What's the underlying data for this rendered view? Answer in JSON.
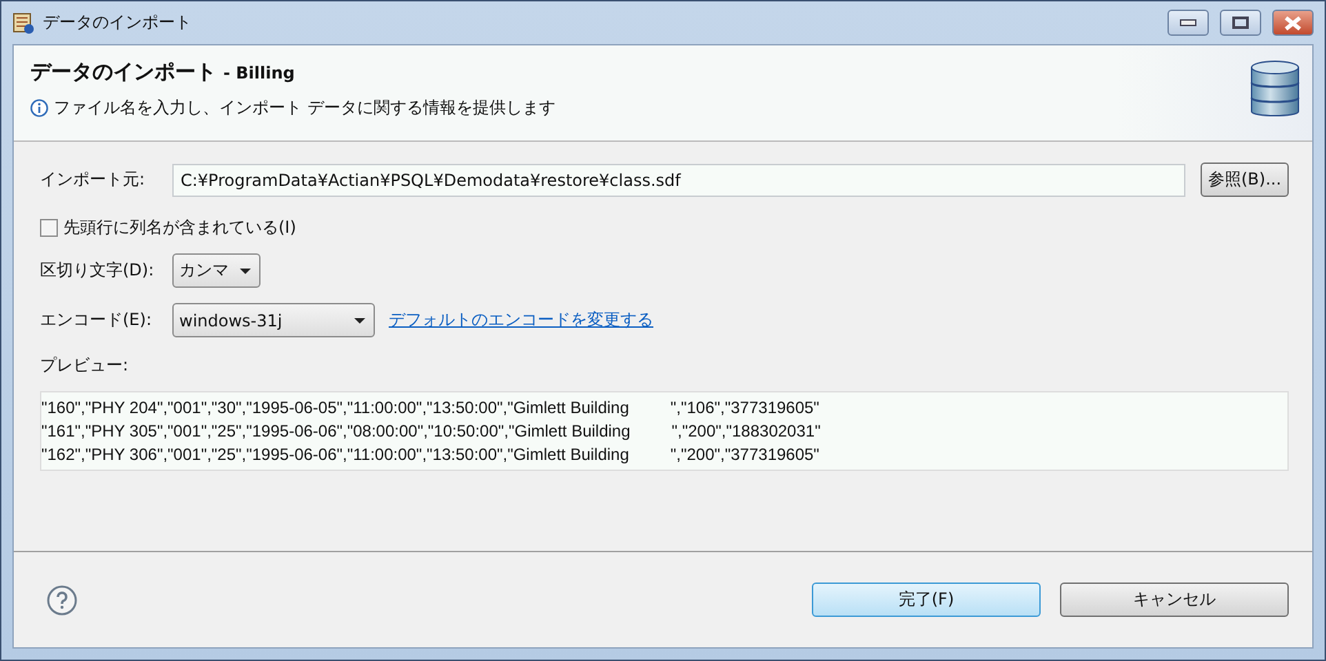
{
  "window": {
    "title": "データのインポート"
  },
  "header": {
    "title": "データのインポート",
    "subtitle": "- Billing",
    "message": "ファイル名を入力し、インポート データに関する情報を提供します"
  },
  "source": {
    "label": "インポート元:",
    "value": "C:¥ProgramData¥Actian¥PSQL¥Demodata¥restore¥class.sdf",
    "browse": "参照(B)..."
  },
  "header_row": {
    "label": "先頭行に列名が含まれている(I)",
    "checked": false
  },
  "delimiter": {
    "label": "区切り文字(D):",
    "value": "カンマ"
  },
  "encoding": {
    "label": "エンコード(E):",
    "value": "windows-31j",
    "link": "デフォルトのエンコードを変更する"
  },
  "preview": {
    "label": "プレビュー:",
    "lines": [
      "\"160\",\"PHY 204\",\"001\",\"30\",\"1995-06-05\",\"11:00:00\",\"13:50:00\",\"Gimlett Building         \",\"106\",\"377319605\"",
      "\"161\",\"PHY 305\",\"001\",\"25\",\"1995-06-06\",\"08:00:00\",\"10:50:00\",\"Gimlett Building         \",\"200\",\"188302031\"",
      "\"162\",\"PHY 306\",\"001\",\"25\",\"1995-06-06\",\"11:00:00\",\"13:50:00\",\"Gimlett Building         \",\"200\",\"377319605\""
    ]
  },
  "buttons": [
    {
      "label": "完了(F)",
      "default": true
    },
    {
      "label": "キャンセル",
      "default": false
    }
  ]
}
